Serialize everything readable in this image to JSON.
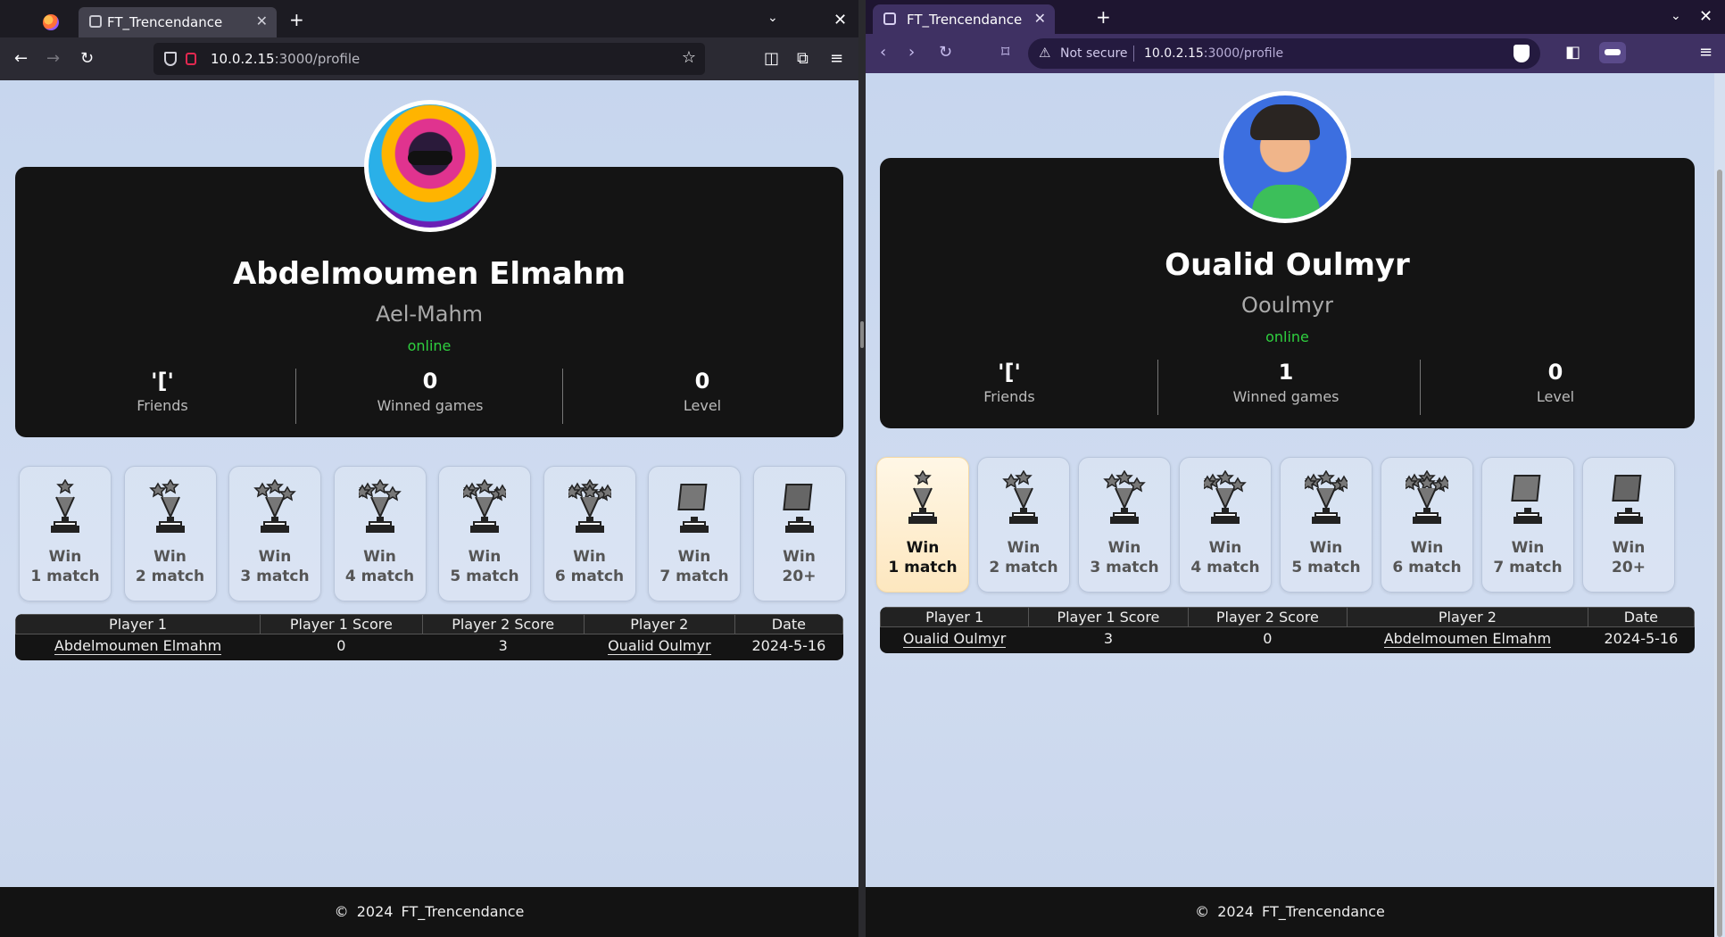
{
  "left_window": {
    "tab_title": "FT_Trencendance",
    "url_host": "10.0.2.15",
    "url_path": ":3000/profile",
    "profile": {
      "full_name": "Abdelmoumen Elmahm",
      "login": "Ael-Mahm",
      "status": "online",
      "friends_value": "'['",
      "friends_label": "Friends",
      "winned_value": "0",
      "winned_label": "Winned games",
      "level_value": "0",
      "level_label": "Level"
    },
    "achievements": [
      {
        "line1": "Win",
        "line2": "1 match"
      },
      {
        "line1": "Win",
        "line2": "2 match"
      },
      {
        "line1": "Win",
        "line2": "3 match"
      },
      {
        "line1": "Win",
        "line2": "4 match"
      },
      {
        "line1": "Win",
        "line2": "5 match"
      },
      {
        "line1": "Win",
        "line2": "6 match"
      },
      {
        "line1": "Win",
        "line2": "7 match"
      },
      {
        "line1": "Win",
        "line2": "20+"
      }
    ],
    "history": {
      "headers": [
        "Player 1",
        "Player 1 Score",
        "Player 2 Score",
        "Player 2",
        "Date"
      ],
      "rows": [
        [
          "Abdelmoumen Elmahm",
          "0",
          "3",
          "Oualid Oulmyr",
          "2024-5-16"
        ]
      ]
    },
    "footer": "©   2024   FT_Trencendance"
  },
  "right_window": {
    "tab_title": "FT_Trencendance",
    "not_secure": "Not secure",
    "url_host": "10.0.2.15",
    "url_path": ":3000/profile",
    "profile": {
      "full_name": "Oualid Oulmyr",
      "login": "Ooulmyr",
      "status": "online",
      "friends_value": "'['",
      "friends_label": "Friends",
      "winned_value": "1",
      "winned_label": "Winned games",
      "level_value": "0",
      "level_label": "Level"
    },
    "achievements": [
      {
        "line1": "Win",
        "line2": "1 match",
        "unlocked": true
      },
      {
        "line1": "Win",
        "line2": "2 match"
      },
      {
        "line1": "Win",
        "line2": "3 match"
      },
      {
        "line1": "Win",
        "line2": "4 match"
      },
      {
        "line1": "Win",
        "line2": "5 match"
      },
      {
        "line1": "Win",
        "line2": "6 match"
      },
      {
        "line1": "Win",
        "line2": "7 match"
      },
      {
        "line1": "Win",
        "line2": "20+"
      }
    ],
    "history": {
      "headers": [
        "Player 1",
        "Player 1 Score",
        "Player 2 Score",
        "Player 2",
        "Date"
      ],
      "rows": [
        [
          "Oualid Oulmyr",
          "3",
          "0",
          "Abdelmoumen Elmahm",
          "2024-5-16"
        ]
      ]
    },
    "footer": "©   2024   FT_Trencendance"
  },
  "icons": [
    "firefox-logo-icon",
    "tab-favicon-icon",
    "back-arrow-icon",
    "forward-arrow-icon",
    "reload-icon",
    "shield-icon",
    "lock-icon",
    "bookmark-star-icon",
    "pocket-icon",
    "extensions-icon",
    "menu-icon",
    "warning-icon",
    "brave-shield-icon",
    "sidebar-icon",
    "wallet-icon",
    "trophy-icon"
  ]
}
